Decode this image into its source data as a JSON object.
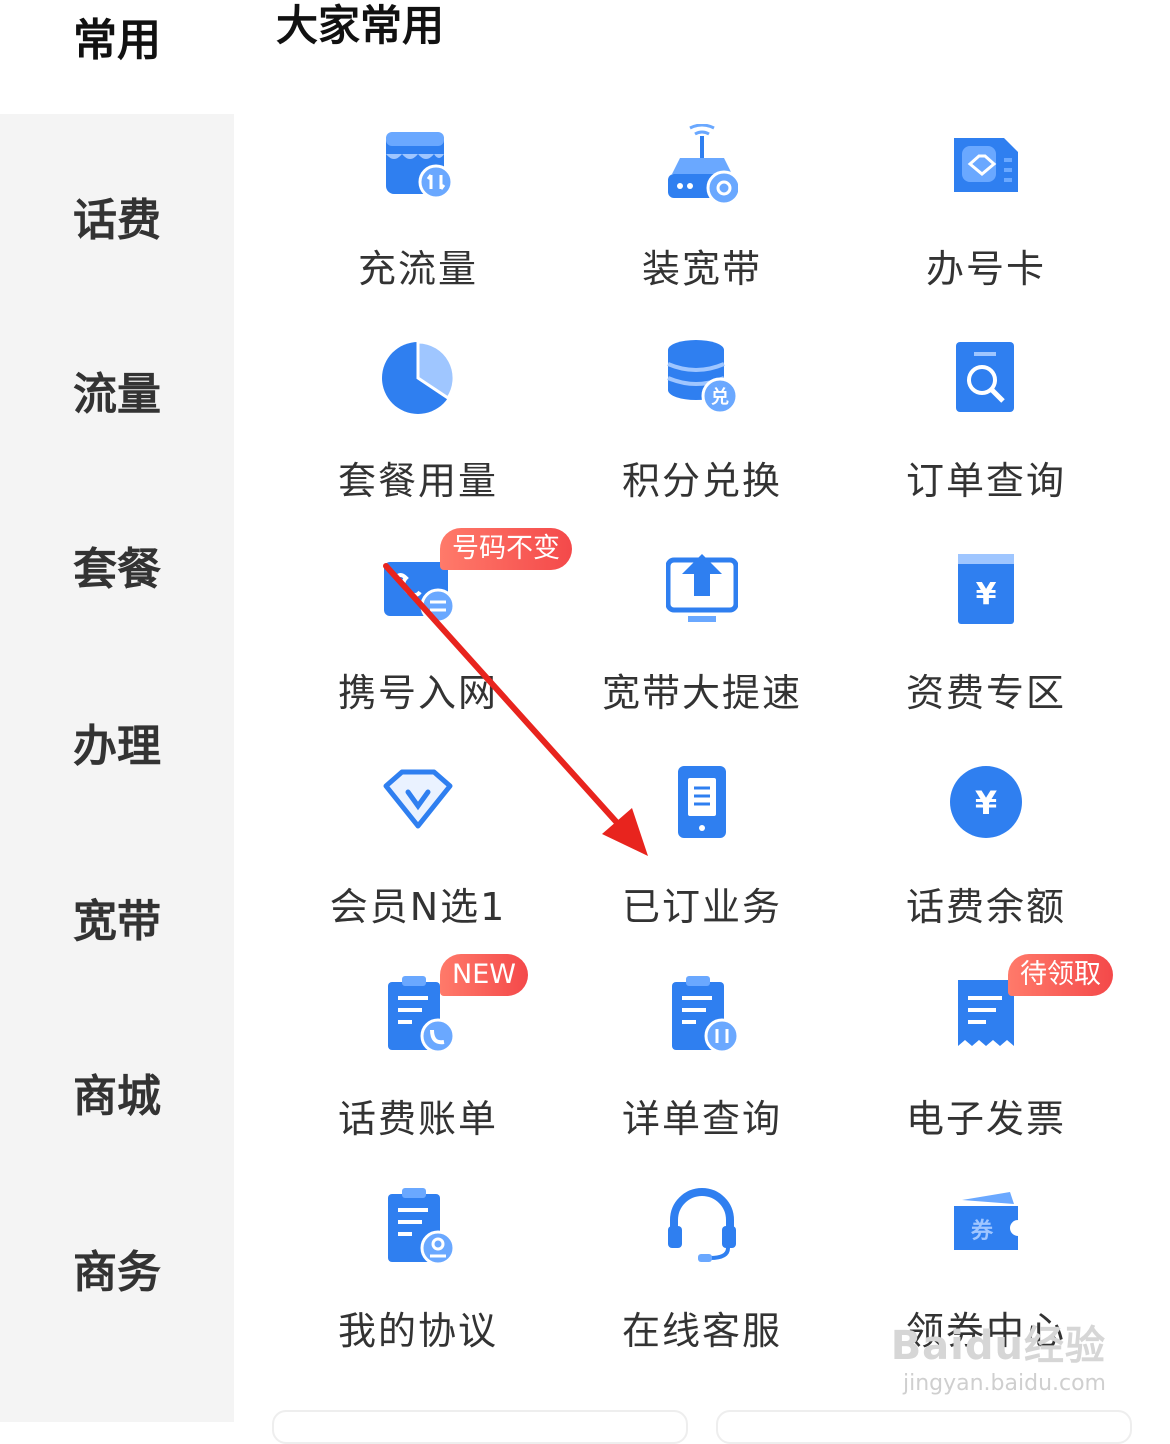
{
  "sidebar": {
    "items": [
      {
        "label": "常用"
      },
      {
        "label": "话费"
      },
      {
        "label": "流量"
      },
      {
        "label": "套餐"
      },
      {
        "label": "办理"
      },
      {
        "label": "宽带"
      },
      {
        "label": "商城"
      },
      {
        "label": "商务"
      }
    ]
  },
  "section": {
    "title": "大家常用"
  },
  "services": [
    {
      "label": "充流量",
      "icon": "shop-data-icon"
    },
    {
      "label": "装宽带",
      "icon": "router-icon"
    },
    {
      "label": "办号卡",
      "icon": "sim-card-icon"
    },
    {
      "label": "套餐用量",
      "icon": "pie-chart-icon"
    },
    {
      "label": "积分兑换",
      "icon": "points-exchange-icon"
    },
    {
      "label": "订单查询",
      "icon": "order-search-icon"
    },
    {
      "label": "携号入网",
      "icon": "number-transfer-icon",
      "badge": "号码不变"
    },
    {
      "label": "宽带大提速",
      "icon": "speed-up-icon"
    },
    {
      "label": "资费专区",
      "icon": "tariff-icon"
    },
    {
      "label": "会员N选1",
      "icon": "vip-diamond-icon"
    },
    {
      "label": "已订业务",
      "icon": "phone-document-icon"
    },
    {
      "label": "话费余额",
      "icon": "yuan-coin-icon"
    },
    {
      "label": "话费账单",
      "icon": "bill-phone-icon",
      "badge": "NEW"
    },
    {
      "label": "详单查询",
      "icon": "detail-bill-icon"
    },
    {
      "label": "电子发票",
      "icon": "invoice-icon",
      "badge": "待领取"
    },
    {
      "label": "我的协议",
      "icon": "agreement-icon"
    },
    {
      "label": "在线客服",
      "icon": "headset-icon"
    },
    {
      "label": "领券中心",
      "icon": "coupon-icon"
    }
  ],
  "coupon_glyph": "券",
  "exchange_glyph": "兑",
  "yuan_glyph": "¥",
  "watermark": {
    "line1": "Baidu经验",
    "line2": "jingyan.baidu.com"
  },
  "colors": {
    "accent": "#2f7ff0",
    "badge": "#f4494a",
    "arrow": "#e8241e"
  }
}
